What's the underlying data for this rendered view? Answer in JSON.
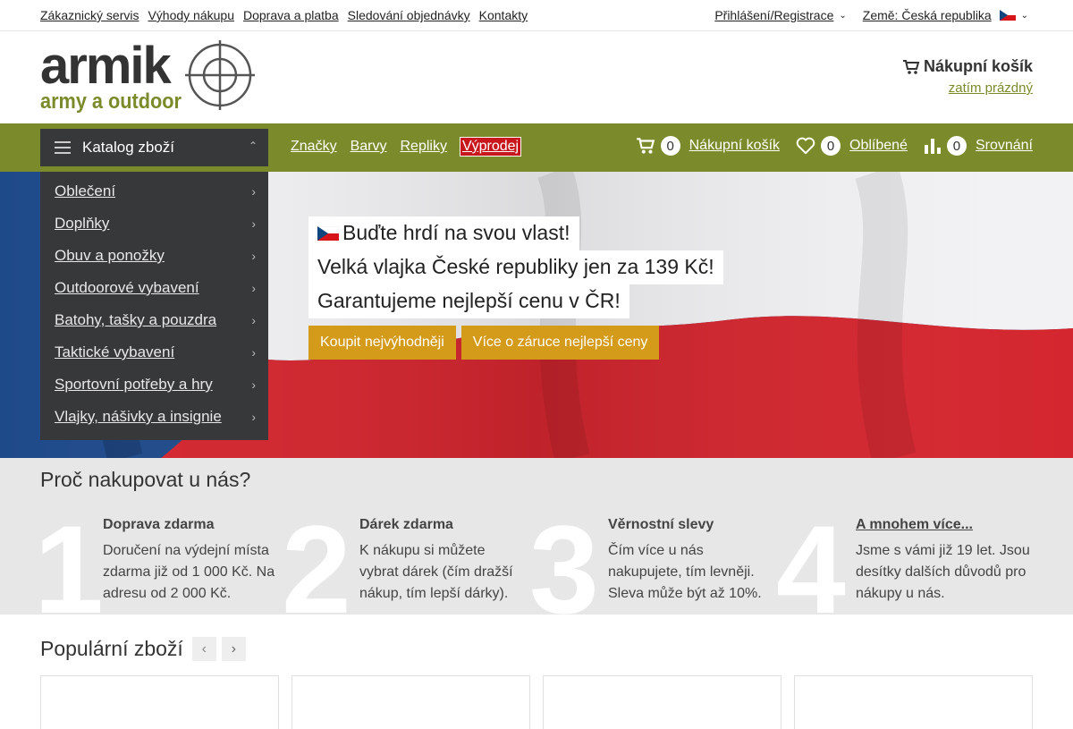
{
  "topbar": {
    "links": [
      "Zákaznický servis",
      "Výhody nákupu",
      "Doprava a platba",
      "Sledování objednávky",
      "Kontakty"
    ],
    "login": "Přihlášení/Registrace",
    "country": "Země: Česká republika"
  },
  "logo": {
    "main": "armik",
    "sub": "army a outdoor"
  },
  "header_cart": {
    "title": "Nákupní košík",
    "status": "zatím prázdný"
  },
  "nav": {
    "catalog": "Katalog zboží",
    "links": [
      "Značky",
      "Barvy",
      "Repliky",
      "Výprodej"
    ],
    "cart_count": "0",
    "cart_label": "Nákupní košík",
    "fav_count": "0",
    "fav_label": "Oblíbené",
    "cmp_count": "0",
    "cmp_label": "Srovnání"
  },
  "menu": [
    "Oblečení",
    "Doplňky",
    "Obuv a ponožky",
    "Outdoorové vybavení",
    "Batohy, tašky a pouzdra",
    "Taktické vybavení",
    "Sportovní potřeby a hry",
    "Vlajky, nášivky a insignie"
  ],
  "promo": {
    "line1": "Buďte hrdí na svou vlast!",
    "line2": "Velká vlajka České republiky jen za 139 Kč!",
    "line3": "Garantujeme nejlepší cenu v ČR!",
    "btn1": "Koupit nejvýhodněji",
    "btn2": "Více o záruce nejlepší ceny"
  },
  "why": {
    "title": "Proč nakupovat u nás?",
    "items": [
      {
        "num": "1",
        "title": "Doprava zdarma",
        "text": "Doručení na výdejní místa zdarma již od 1 000 Kč. Na adresu od 2 000 Kč."
      },
      {
        "num": "2",
        "title": "Dárek zdarma",
        "text": "K nákupu si můžete vybrat dárek (čím dražší nákup, tím lepší dárky)."
      },
      {
        "num": "3",
        "title": "Věrnostní slevy",
        "text": "Čím více u nás nakupujete, tím levněji. Sleva může být až 10%."
      },
      {
        "num": "4",
        "title": "A mnohem více...",
        "text": "Jsme s vámi již 19 let. Jsou desítky dalších důvodů pro nákupy u nás."
      }
    ]
  },
  "popular": {
    "title": "Populární zboží"
  },
  "colors": {
    "olive": "#7b8a2a",
    "dark": "#37383a",
    "sale": "#c8161d",
    "button": "#d49a1a"
  }
}
